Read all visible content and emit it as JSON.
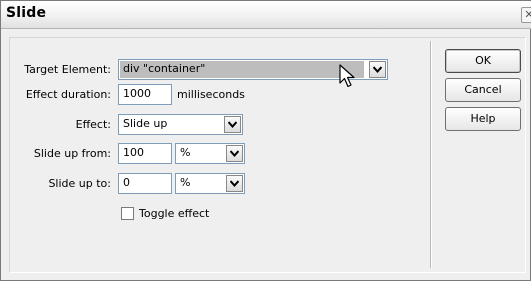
{
  "window": {
    "title": "Slide",
    "close_glyph": "✕"
  },
  "form": {
    "target_element": {
      "label": "Target Element:",
      "value": "div \"container\""
    },
    "effect_duration": {
      "label": "Effect duration:",
      "value": "1000",
      "unit": "milliseconds"
    },
    "effect": {
      "label": "Effect:",
      "value": "Slide up"
    },
    "slide_from": {
      "label": "Slide up from:",
      "value": "100",
      "unit_value": "%"
    },
    "slide_to": {
      "label": "Slide up to:",
      "value": "0",
      "unit_value": "%"
    },
    "toggle": {
      "label": "Toggle effect",
      "checked": false
    }
  },
  "buttons": {
    "ok": "OK",
    "cancel": "Cancel",
    "help": "Help"
  },
  "icons": {
    "dropdown": "chevron-down-icon",
    "cursor": "mouse-pointer-icon",
    "close": "close-icon"
  }
}
